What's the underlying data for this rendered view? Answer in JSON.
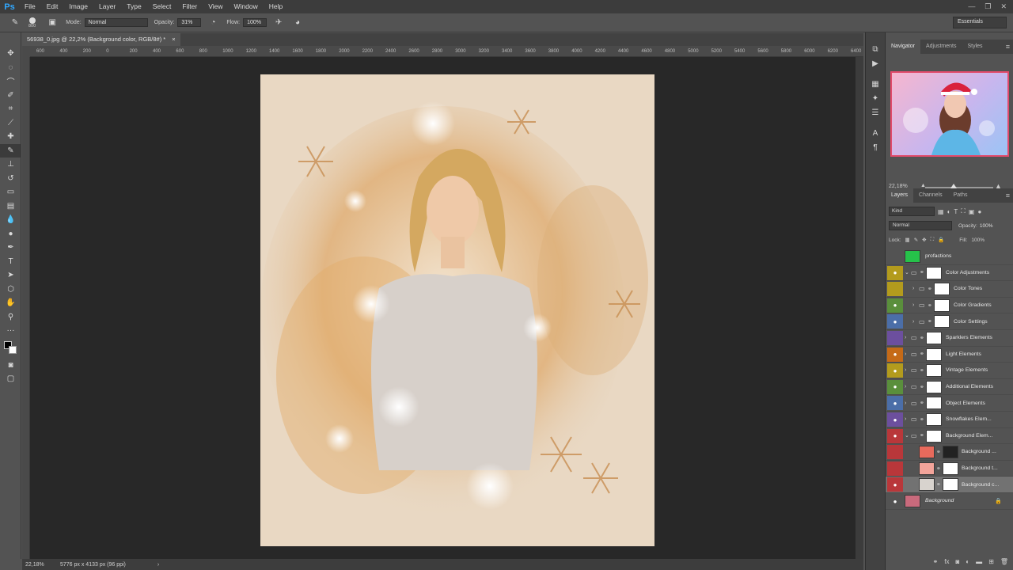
{
  "menubar": {
    "logo": "Ps",
    "items": [
      "File",
      "Edit",
      "Image",
      "Layer",
      "Type",
      "Select",
      "Filter",
      "View",
      "Window",
      "Help"
    ],
    "window_controls": [
      "—",
      "❐",
      "✕"
    ]
  },
  "options": {
    "brush_size": "800",
    "mode_label": "Mode:",
    "mode_value": "Normal",
    "opacity_label": "Opacity:",
    "opacity_value": "31%",
    "flow_label": "Flow:",
    "flow_value": "100%",
    "workspace": "Essentials"
  },
  "document": {
    "tab_title": "56938_0.jpg @ 22,2% (Background color, RGB/8#) *",
    "close": "×"
  },
  "ruler": {
    "h_ticks": [
      "600",
      "400",
      "200",
      "0",
      "200",
      "400",
      "600",
      "800",
      "1000",
      "1200",
      "1400",
      "1600",
      "1800",
      "2000",
      "2200",
      "2400",
      "2600",
      "2800",
      "3000",
      "3200",
      "3400",
      "3600",
      "3800",
      "4000",
      "4200",
      "4400",
      "4600",
      "4800",
      "5000",
      "5200",
      "5400",
      "5600",
      "5800",
      "6000",
      "6200",
      "6400"
    ]
  },
  "status": {
    "zoom": "22,18%",
    "info": "5776 px x 4133 px (96 ppi)",
    "arrow": "›"
  },
  "panels": {
    "top_tabs": [
      "Navigator",
      "Adjustments",
      "Styles"
    ],
    "navigator_zoom": "22,18%",
    "layer_tabs": [
      "Layers",
      "Channels",
      "Paths"
    ],
    "filter_kind": "Kind",
    "blend_mode": "Normal",
    "opacity_label": "Opacity:",
    "opacity_value": "100%",
    "lock_label": "Lock:",
    "fill_label": "Fill:",
    "fill_value": "100%"
  },
  "layers": [
    {
      "name": "profactions",
      "visible": false,
      "color": "",
      "type": "layer",
      "indent": 0,
      "thumb": "#26c24a"
    },
    {
      "name": "Color Adjustments",
      "visible": true,
      "color": "#b39b1d",
      "type": "group",
      "indent": 0,
      "expanded": true
    },
    {
      "name": "Color Tones",
      "visible": false,
      "color": "#b39b1d",
      "type": "group",
      "indent": 1
    },
    {
      "name": "Color Gradients",
      "visible": true,
      "color": "#5a8f3c",
      "type": "group",
      "indent": 1
    },
    {
      "name": "Color Settings",
      "visible": true,
      "color": "#4b6ea8",
      "type": "group",
      "indent": 1
    },
    {
      "name": "Sparklers Elements",
      "visible": false,
      "color": "#6c4f9e",
      "type": "group",
      "indent": 0
    },
    {
      "name": "Light Elements",
      "visible": true,
      "color": "#c56a17",
      "type": "group",
      "indent": 0
    },
    {
      "name": "Vintage Elements",
      "visible": true,
      "color": "#b39b1d",
      "type": "group",
      "indent": 0
    },
    {
      "name": "Additional Elements",
      "visible": true,
      "color": "#5a8f3c",
      "type": "group",
      "indent": 0
    },
    {
      "name": "Object Elements",
      "visible": true,
      "color": "#4b6ea8",
      "type": "group",
      "indent": 0
    },
    {
      "name": "Snowflakes Elem...",
      "visible": true,
      "color": "#6c4f9e",
      "type": "group",
      "indent": 0
    },
    {
      "name": "Background Elem...",
      "visible": true,
      "color": "#b9373a",
      "type": "group",
      "indent": 0,
      "expanded": true
    },
    {
      "name": "Background ...",
      "visible": false,
      "color": "#b9373a",
      "type": "layer",
      "indent": 1,
      "thumb": "#e86a5c"
    },
    {
      "name": "Background t...",
      "visible": false,
      "color": "#b9373a",
      "type": "layer",
      "indent": 1,
      "thumb": "#f3a49a"
    },
    {
      "name": "Background c...",
      "visible": true,
      "color": "#b9373a",
      "type": "layer",
      "indent": 1,
      "thumb": "#d8d3ce",
      "selected": true
    },
    {
      "name": "Background",
      "visible": true,
      "color": "",
      "type": "background",
      "indent": 0,
      "thumb": "#c96a7c",
      "locked": true
    }
  ],
  "colors": {
    "accent": "#31a8ff",
    "canvas_bg": "#282828",
    "artwork_bg": "#e7d6c0"
  }
}
